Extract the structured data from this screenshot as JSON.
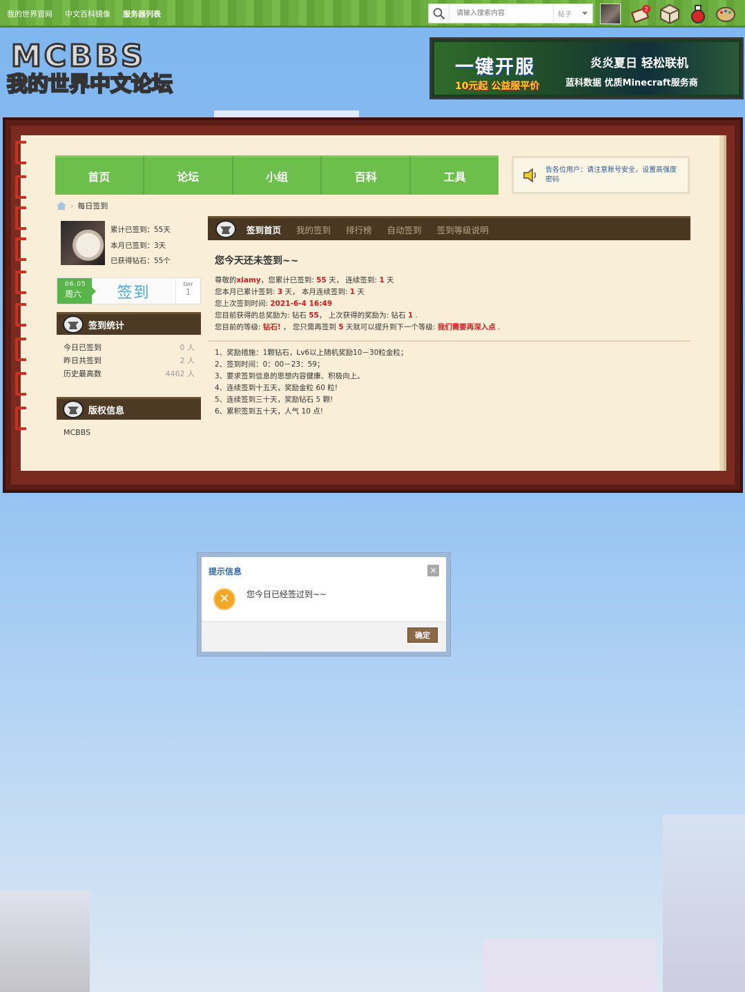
{
  "topbar": {
    "links": [
      "我的世界官网",
      "中文百科镜像",
      "服务器列表"
    ],
    "search": {
      "placeholder": "请输入搜索内容",
      "type_selected": "帖子"
    }
  },
  "header": {
    "logo_text": "MCBBS 我的世界中文论坛",
    "banner": {
      "line1": "一键开服",
      "line2": "10元起 公益服平价",
      "line3": "炎炎夏日 轻松联机",
      "line4": "蓝科数据  优质Minecraft服务商"
    }
  },
  "nav": {
    "items": [
      "首页",
      "论坛",
      "小组",
      "百科",
      "工具"
    ],
    "notice": "告各位用户：请注意账号安全，设置高强度密码"
  },
  "breadcrumb": {
    "current": "每日签到"
  },
  "sidebar": {
    "stats": [
      "累计已签到：55天",
      "本月已签到：3天",
      "已获得钻石：55个"
    ],
    "sign": {
      "date": "06.05",
      "weekday": "周六",
      "button": "签到",
      "day_label": "DAY",
      "day_value": "1"
    },
    "checkin_stats": {
      "title": "签到统计",
      "rows": [
        {
          "label": "今日已签到",
          "value": "0 人"
        },
        {
          "label": "昨日共签到",
          "value": "2 人"
        },
        {
          "label": "历史最高数",
          "value": "4462 人"
        }
      ]
    },
    "copyright": {
      "title": "版权信息",
      "text": "MCBBS"
    }
  },
  "content": {
    "tabs": [
      "签到首页",
      "我的签到",
      "排行榜",
      "自动签到",
      "签到等级说明"
    ],
    "title": "您今天还未签到~~",
    "info": {
      "l1a": "尊敬的",
      "username": "xiamy",
      "l1b": "，您累计已签到: ",
      "total": "55",
      "l1c": " 天， 连续签到: ",
      "streak": "1",
      "l1d": " 天",
      "l2a": "您本月已累计签到: ",
      "month": "3",
      "l2b": " 天， 本月连续签到: ",
      "month_streak": "1",
      "l2c": " 天",
      "l3a": "您上次签到时间: ",
      "last_time": "2021-6-4 16:49",
      "l4a": "您目前获得的总奖励为: 钻石 ",
      "total_reward": "55",
      "l4b": "， 上次获得的奖励为: 钻石 ",
      "last_reward": "1",
      "l4c": " .",
      "l5a": "您目前的等级: ",
      "level": "钻石!",
      "l5b": " ， 您只需再签到 ",
      "need": "5",
      "l5c": " 天就可以提升到下一个等级: ",
      "next_level": "我们需要再深入点",
      "l5d": " ."
    },
    "rules": [
      "1、奖励措施：1颗钻石，Lv6以上随机奖励10－30粒金粒；",
      "2、签到时间：0：00－23：59；",
      "3、要求签到信息的思想内容健康、积极向上。",
      "4、连续签到十五天，奖励金粒 60 粒!",
      "5、连续签到三十天，奖励钻石 5 颗!",
      "6、累积签到五十天，人气 10 点!"
    ]
  },
  "dialog": {
    "title": "提示信息",
    "close": "×",
    "message": "您今日已经签过到~~",
    "ok": "确定"
  }
}
